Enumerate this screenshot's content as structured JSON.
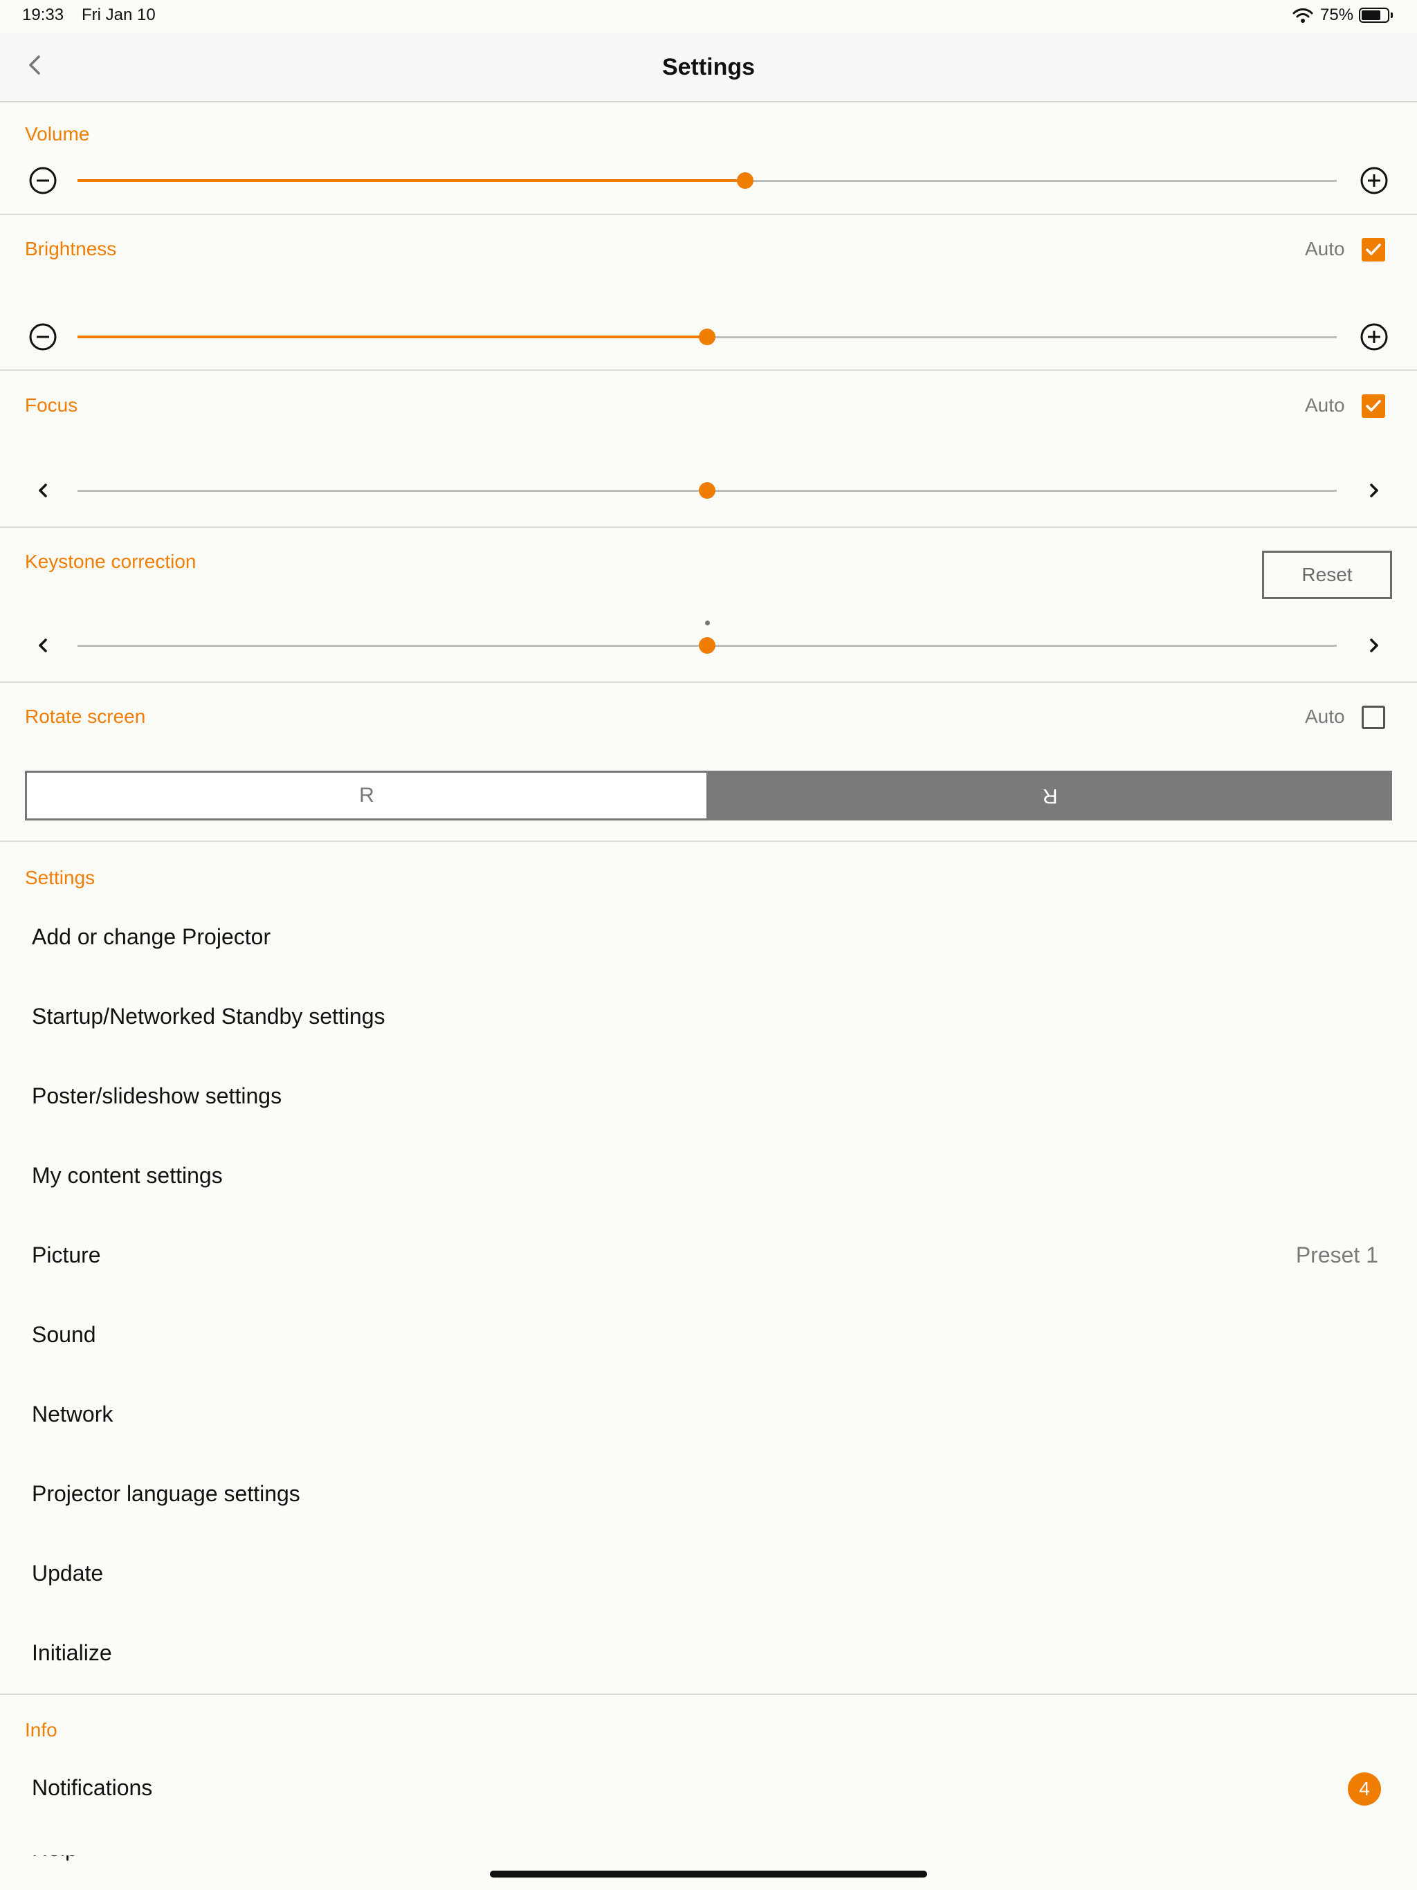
{
  "status_bar": {
    "time": "19:33",
    "date": "Fri Jan 10",
    "battery_percent": "75%",
    "battery_level": 0.75
  },
  "nav": {
    "title": "Settings",
    "back_icon": "chevron-left-icon"
  },
  "accent_color": "#ef7d00",
  "volume": {
    "label": "Volume",
    "level": 0.53,
    "decrease_icon": "minus-circle-icon",
    "increase_icon": "plus-circle-icon"
  },
  "brightness": {
    "label": "Brightness",
    "auto_label": "Auto",
    "auto_checked": true,
    "level": 0.5
  },
  "focus": {
    "label": "Focus",
    "auto_label": "Auto",
    "auto_checked": true,
    "level": 0.5
  },
  "keystone": {
    "label": "Keystone correction",
    "reset_label": "Reset",
    "level": 0.5
  },
  "rotate": {
    "label": "Rotate screen",
    "auto_label": "Auto",
    "auto_checked": false,
    "normal_label": "R",
    "flipped_label": "R",
    "selected": "flipped"
  },
  "settings_section": {
    "header": "Settings",
    "items": [
      {
        "label": "Add or change Projector",
        "value": ""
      },
      {
        "label": "Startup/Networked Standby settings",
        "value": ""
      },
      {
        "label": "Poster/slideshow settings",
        "value": ""
      },
      {
        "label": "My content settings",
        "value": ""
      },
      {
        "label": "Picture",
        "value": "Preset 1"
      },
      {
        "label": "Sound",
        "value": ""
      },
      {
        "label": "Network",
        "value": ""
      },
      {
        "label": "Projector language settings",
        "value": ""
      },
      {
        "label": "Update",
        "value": ""
      },
      {
        "label": "Initialize",
        "value": ""
      }
    ]
  },
  "info_section": {
    "header": "Info",
    "items": [
      {
        "label": "Notifications",
        "badge": "4"
      },
      {
        "label": "Help"
      }
    ]
  }
}
